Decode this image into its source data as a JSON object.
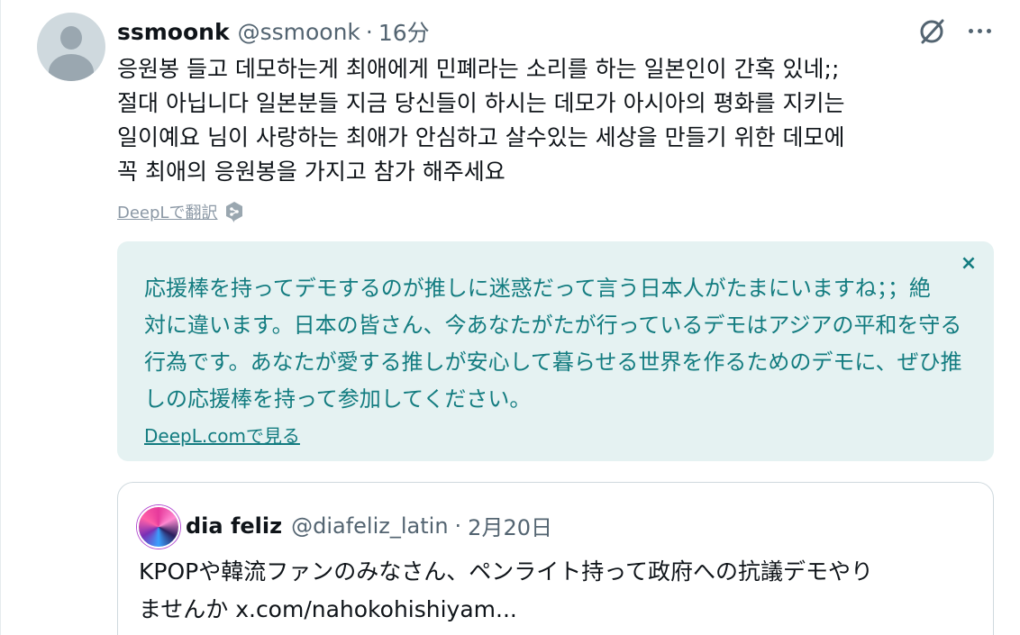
{
  "tweet": {
    "display_name": "ssmoonk",
    "handle": "@ssmoonk",
    "separator": "·",
    "time": "16分",
    "avatar_icon": "default-user-avatar",
    "text_lines": [
      "응원봉 들고 데모하는게 최애에게 민폐라는 소리를 하는 일본인이 간혹 있네;;",
      "절대 아닙니다 일본분들 지금 당신들이 하시는 데모가 아시아의 평화를 지키는",
      "일이예요 님이 사랑하는 최애가 안심하고 살수있는 세상을 만들기 위한 데모에",
      "꼭 최애의 응원봉을 가지고 참가 해주세요"
    ]
  },
  "actions": {
    "grok_icon": "grok-icon",
    "more_icon": "more-horizontal-icon"
  },
  "translate": {
    "link_label": "DeepLで翻訳",
    "icon": "deepl-icon"
  },
  "translation": {
    "lines": [
      "応援棒を持ってデモするのが推しに迷惑だって言う日本人がたまにいますね；；絶",
      "対に違います。日本の皆さん、今あなたがたが行っているデモはアジアの平和を守る",
      "行為です。あなたが愛する推しが安心して暮らせる世界を作るためのデモに、ぜひ推",
      "しの応援棒を持って参加してください。"
    ],
    "close_label": "×",
    "source_link": "DeepL.comで見る"
  },
  "quote": {
    "display_name": "dia feliz",
    "handle": "@diafeliz_latin",
    "separator": "·",
    "time": "2月20日",
    "text_lines": [
      "KPOPや韓流ファンのみなさん、ペンライト持って政府への抗議デモやり",
      "ませんか x.com/nahokohishiyam..."
    ]
  },
  "colors": {
    "text_primary": "#0f1419",
    "text_secondary": "#536471",
    "translation_bg": "#e5f2f2",
    "translation_text": "#137c80",
    "border": "#cfd9de"
  }
}
